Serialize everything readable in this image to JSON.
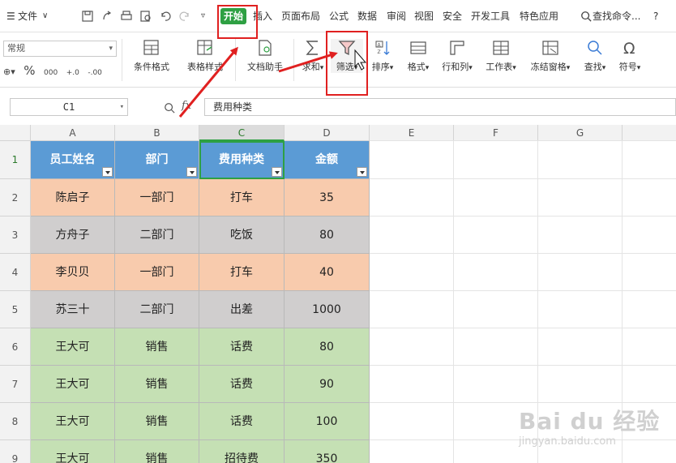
{
  "menubar": {
    "file_label": "文件",
    "tabs": [
      "开始",
      "插入",
      "页面布局",
      "公式",
      "数据",
      "审阅",
      "视图",
      "安全",
      "开发工具",
      "特色应用"
    ],
    "search_label": "查找命令...",
    "help_label": "?"
  },
  "ribbon": {
    "number_format": "常规",
    "number_symbols": [
      "%",
      "000",
      "+.0",
      "-.00"
    ],
    "buttons": {
      "conditional_format": "条件格式",
      "table_style": "表格样式",
      "doc_assistant": "文档助手",
      "sum": "求和",
      "filter": "筛选",
      "sort": "排序",
      "format": "格式",
      "rows_cols": "行和列",
      "worksheet": "工作表",
      "freeze": "冻结窗格",
      "find": "查找",
      "symbol": "符号"
    }
  },
  "formula_bar": {
    "cell_ref": "C1",
    "fx": "fx",
    "content": "费用种类"
  },
  "sheet": {
    "columns": [
      "A",
      "B",
      "C",
      "D",
      "E",
      "F",
      "G"
    ],
    "row_numbers": [
      "1",
      "2",
      "3",
      "4",
      "5",
      "6",
      "7",
      "8",
      "9"
    ],
    "headers": [
      "员工姓名",
      "部门",
      "费用种类",
      "金额"
    ],
    "rows": [
      [
        "陈启子",
        "一部门",
        "打车",
        "35"
      ],
      [
        "方舟子",
        "二部门",
        "吃饭",
        "80"
      ],
      [
        "李贝贝",
        "一部门",
        "打车",
        "40"
      ],
      [
        "苏三十",
        "二部门",
        "出差",
        "1000"
      ],
      [
        "王大可",
        "销售",
        "话费",
        "80"
      ],
      [
        "王大可",
        "销售",
        "话费",
        "90"
      ],
      [
        "王大可",
        "销售",
        "话费",
        "100"
      ],
      [
        "王大可",
        "销售",
        "招待费",
        "350"
      ]
    ],
    "row_colors": [
      "#f8cbad",
      "#d0cece",
      "#f8cbad",
      "#d0cece",
      "#c5e0b4",
      "#c5e0b4",
      "#c5e0b4",
      "#c5e0b4"
    ],
    "header_color": "#5b9bd5"
  },
  "watermark": {
    "main": "Bai du 经验",
    "sub": "jingyan.baidu.com"
  },
  "colors": {
    "accent_green": "#2ea043",
    "annotation_red": "#e02020"
  }
}
